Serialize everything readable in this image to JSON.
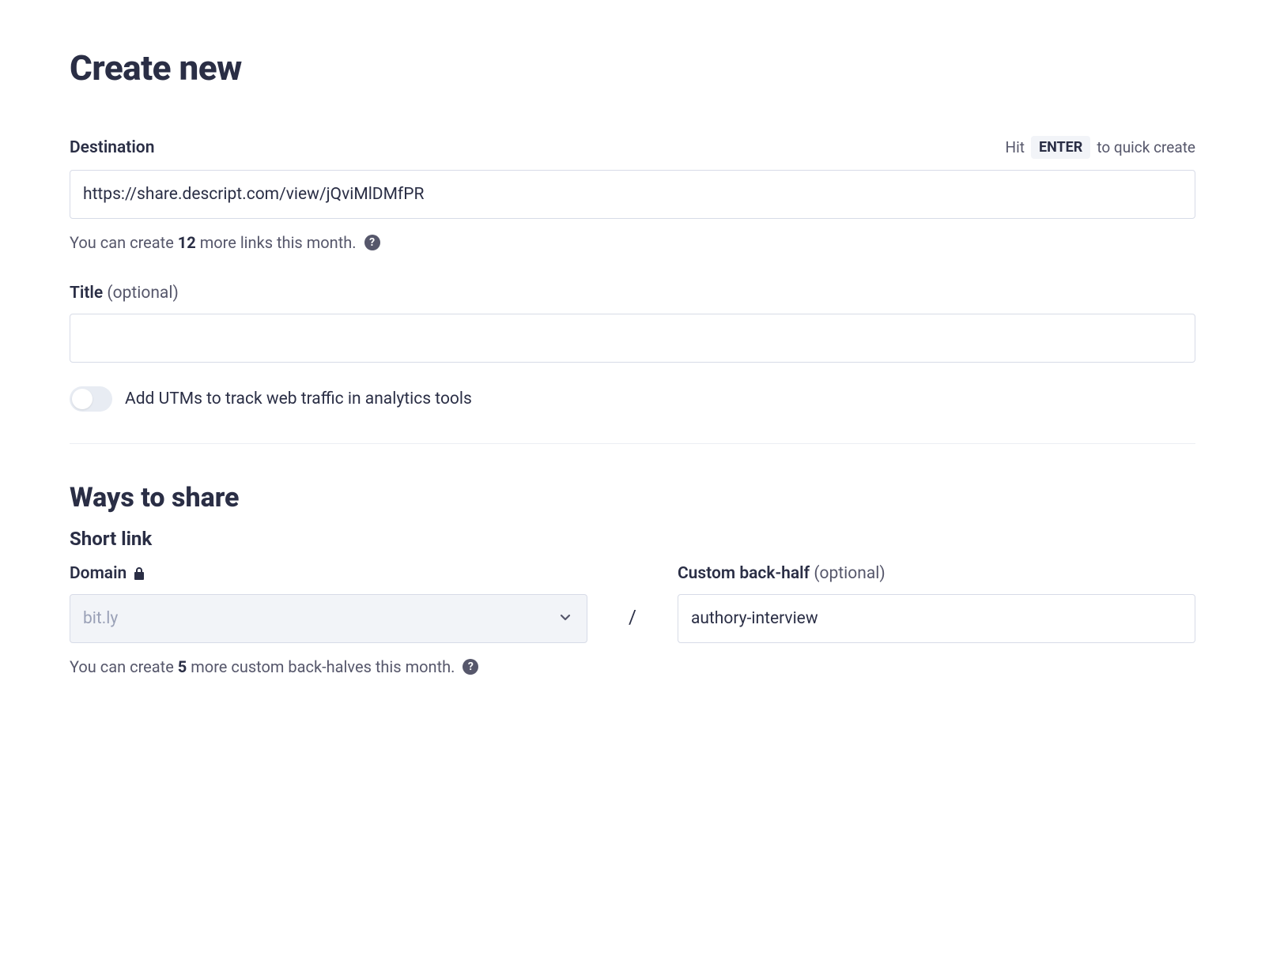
{
  "page": {
    "title": "Create new"
  },
  "destination": {
    "label": "Destination",
    "hint_prefix": "Hit",
    "hint_key": "ENTER",
    "hint_suffix": "to quick create",
    "value": "https://share.descript.com/view/jQviMlDMfPR",
    "helper_prefix": "You can create",
    "helper_count": "12",
    "helper_suffix": "more links this month."
  },
  "title_field": {
    "label": "Title",
    "optional": "(optional)",
    "value": ""
  },
  "utm": {
    "label": "Add UTMs to track web traffic in analytics tools"
  },
  "share": {
    "section_title": "Ways to share",
    "short_link_title": "Short link",
    "domain_label": "Domain",
    "domain_value": "bit.ly",
    "separator": "/",
    "backhalf_label": "Custom back-half",
    "backhalf_optional": "(optional)",
    "backhalf_value": "authory-interview",
    "helper_prefix": "You can create",
    "helper_count": "5",
    "helper_suffix": "more custom back-halves this month."
  }
}
